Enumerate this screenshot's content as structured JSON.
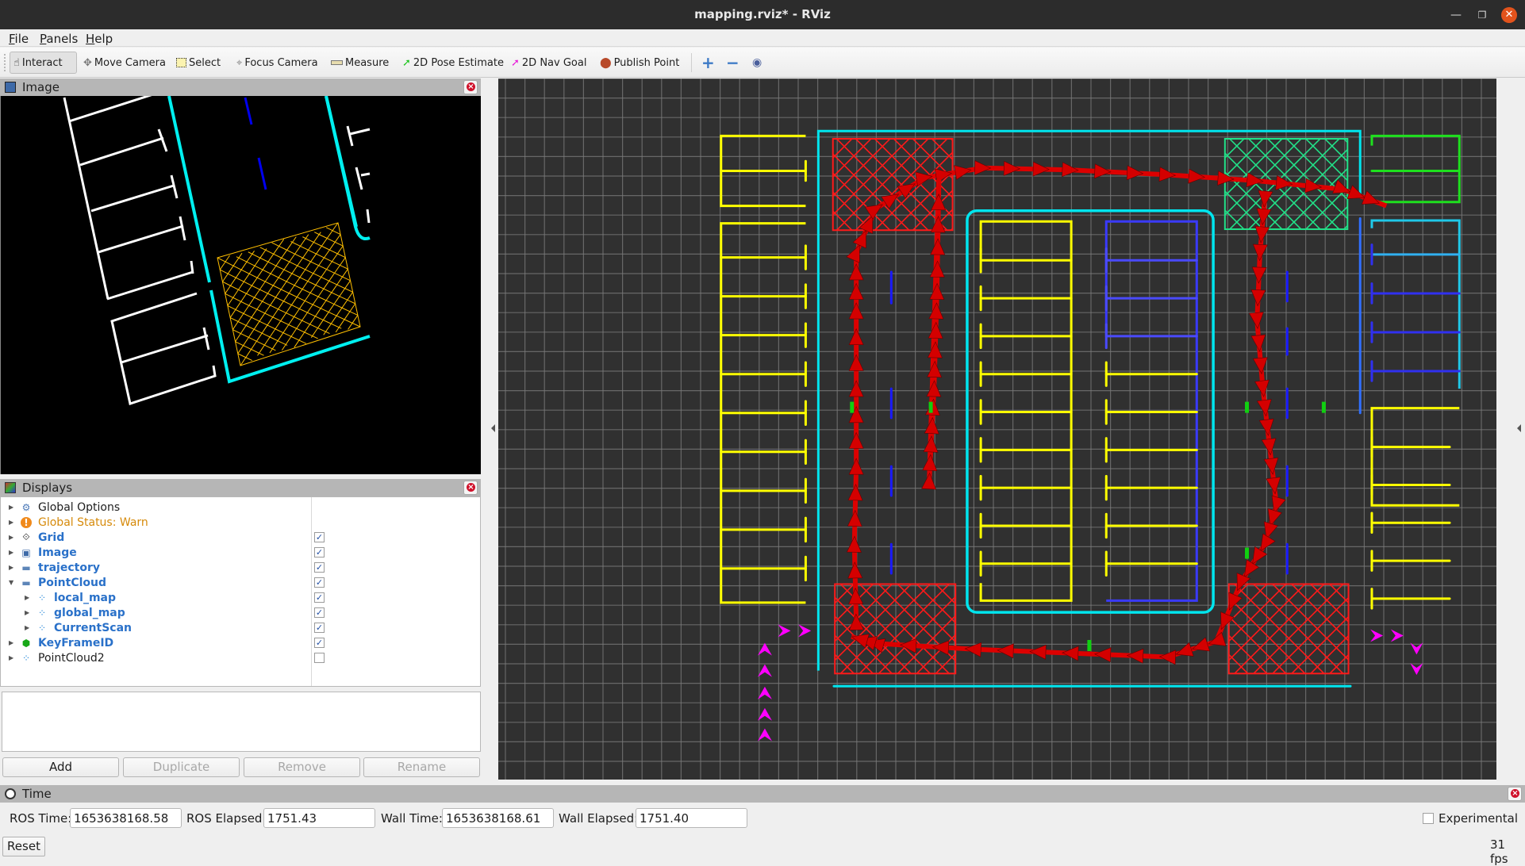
{
  "window": {
    "title": "mapping.rviz* - RViz",
    "minimize_icon": "minimize-icon",
    "maximize_icon": "restore-icon",
    "close_icon": "close-icon"
  },
  "menu": [
    {
      "label": "File",
      "mnemonic": "F",
      "rest": "ile"
    },
    {
      "label": "Panels",
      "mnemonic": "P",
      "rest": "anels"
    },
    {
      "label": "Help",
      "mnemonic": "H",
      "rest": "elp"
    }
  ],
  "toolbar": {
    "tools": [
      {
        "label": "Interact",
        "icon": "hand-pointer-icon",
        "active": true
      },
      {
        "label": "Move Camera",
        "icon": "move-arrows-icon",
        "active": false
      },
      {
        "label": "Select",
        "icon": "select-box-icon",
        "active": false
      },
      {
        "label": "Focus Camera",
        "icon": "crosshair-icon",
        "active": false
      },
      {
        "label": "Measure",
        "icon": "ruler-icon",
        "active": false
      },
      {
        "label": "2D Pose Estimate",
        "icon": "green-arrow-icon",
        "active": false
      },
      {
        "label": "2D Nav Goal",
        "icon": "magenta-arrow-icon",
        "active": false
      },
      {
        "label": "Publish Point",
        "icon": "map-pin-icon",
        "active": false
      }
    ],
    "add_tool_icon": "plus-icon",
    "remove_tool_icon": "minus-icon",
    "visibility_icon": "eye-icon"
  },
  "image_panel": {
    "title": "Image"
  },
  "displays_panel": {
    "title": "Displays",
    "items": [
      {
        "label": "Global Options",
        "icon": "gear-icon",
        "style": "normal",
        "checkbox": null,
        "indent": 0,
        "expanded": false
      },
      {
        "label": "Global Status: Warn",
        "icon": "warning-icon",
        "style": "warn",
        "checkbox": null,
        "indent": 0,
        "expanded": false
      },
      {
        "label": "Grid",
        "icon": "grid-icon",
        "style": "blue",
        "checkbox": true,
        "indent": 0,
        "expanded": false
      },
      {
        "label": "Image",
        "icon": "image-icon",
        "style": "blue",
        "checkbox": true,
        "indent": 0,
        "expanded": false
      },
      {
        "label": "trajectory",
        "icon": "folder-icon",
        "style": "blue",
        "checkbox": true,
        "indent": 0,
        "expanded": false
      },
      {
        "label": "PointCloud",
        "icon": "folder-icon",
        "style": "blue",
        "checkbox": true,
        "indent": 0,
        "expanded": true
      },
      {
        "label": "local_map",
        "icon": "pointcloud-icon",
        "style": "blue",
        "checkbox": true,
        "indent": 1,
        "expanded": false
      },
      {
        "label": "global_map",
        "icon": "pointcloud-icon",
        "style": "blue",
        "checkbox": true,
        "indent": 1,
        "expanded": false
      },
      {
        "label": "CurrentScan",
        "icon": "pointcloud-icon",
        "style": "blue",
        "checkbox": true,
        "indent": 1,
        "expanded": false
      },
      {
        "label": "KeyFrameID",
        "icon": "green-cube-icon",
        "style": "blue",
        "checkbox": true,
        "indent": 0,
        "expanded": false
      },
      {
        "label": "PointCloud2",
        "icon": "pointcloud-icon",
        "style": "normal",
        "checkbox": false,
        "indent": 0,
        "expanded": false
      }
    ],
    "buttons": [
      {
        "label": "Add",
        "enabled": true
      },
      {
        "label": "Duplicate",
        "enabled": false
      },
      {
        "label": "Remove",
        "enabled": false
      },
      {
        "label": "Rename",
        "enabled": false
      }
    ]
  },
  "time_panel": {
    "title": "Time",
    "ros_time_label": "ROS Time:",
    "ros_time": "1653638168.58",
    "ros_elapsed_label": "ROS Elapsed:",
    "ros_elapsed": "1751.43",
    "wall_time_label": "Wall Time:",
    "wall_time": "1653638168.61",
    "wall_elapsed_label": "Wall Elapsed:",
    "wall_elapsed": "1751.40",
    "experimental_label": "Experimental",
    "experimental_checked": false,
    "reset_label": "Reset",
    "fps": "31 fps"
  },
  "colors": {
    "parking_lines": "#ffff00",
    "curb": "#00e5ee",
    "lane_dash": "#1a1aff",
    "no_parking_hatch": "#ff1a1a",
    "trajectory": "#dd0000",
    "arrow_marks": "#ff00ff",
    "camera_hatch": "#ffc000",
    "grid": "#7a7a7a",
    "status_warn": "#d68a0a",
    "close_button": "#e2531c"
  }
}
